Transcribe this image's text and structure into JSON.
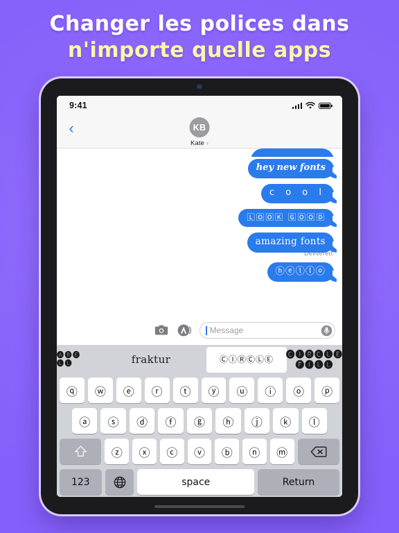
{
  "headline": {
    "line1": "Changer les polices dans",
    "line2": "n'importe quelle apps",
    "color_line1": "#ffffff",
    "color_line2": "#fbf6a8",
    "background": "#8b66fb"
  },
  "status_bar": {
    "time": "9:41",
    "signal_icon": "cellular-bars-icon",
    "wifi_icon": "wifi-icon",
    "battery_icon": "battery-full-icon"
  },
  "nav_bar": {
    "back_icon": "chevron-left-icon",
    "avatar_initials": "KB",
    "contact_name": "Kate"
  },
  "thread": {
    "accent": "#2a7bec",
    "messages": [
      {
        "text": "hey new fonts",
        "style": "bold-italic-serif"
      },
      {
        "text": "c o o l",
        "style": "wide-spaced"
      },
      {
        "text": "LOOK GOOD",
        "style": "squared-boxed"
      },
      {
        "text": "amazing fonts",
        "style": "fraktur-serif"
      },
      {
        "text": "hello",
        "style": "circled"
      }
    ],
    "delivered_label": "Delivered"
  },
  "input_bar": {
    "camera_icon": "camera-icon",
    "appstore_icon": "app-store-icon",
    "placeholder": "Message",
    "mic_icon": "microphone-icon"
  },
  "font_bar": {
    "items": [
      {
        "line1": "ARE",
        "line2": "LL",
        "style": "square-fill",
        "selected": false
      },
      {
        "line1": "fraktur",
        "line2": "",
        "style": "fraktur",
        "selected": false
      },
      {
        "line1": "CIRCLE",
        "line2": "",
        "style": "circle",
        "selected": true
      },
      {
        "line1": "CIRCLE",
        "line2": "FILL",
        "style": "circle-fill",
        "selected": false
      }
    ]
  },
  "keyboard": {
    "row1": [
      "q",
      "w",
      "e",
      "r",
      "t",
      "y",
      "u",
      "i",
      "o",
      "p"
    ],
    "row2": [
      "a",
      "s",
      "d",
      "f",
      "g",
      "h",
      "j",
      "k",
      "l"
    ],
    "row3": [
      "z",
      "x",
      "c",
      "v",
      "b",
      "n",
      "m"
    ],
    "shift_icon": "shift-arrow-icon",
    "delete_icon": "backspace-icon",
    "numeric_label": "123",
    "globe_icon": "globe-icon",
    "space_label": "space",
    "return_label": "Return"
  }
}
